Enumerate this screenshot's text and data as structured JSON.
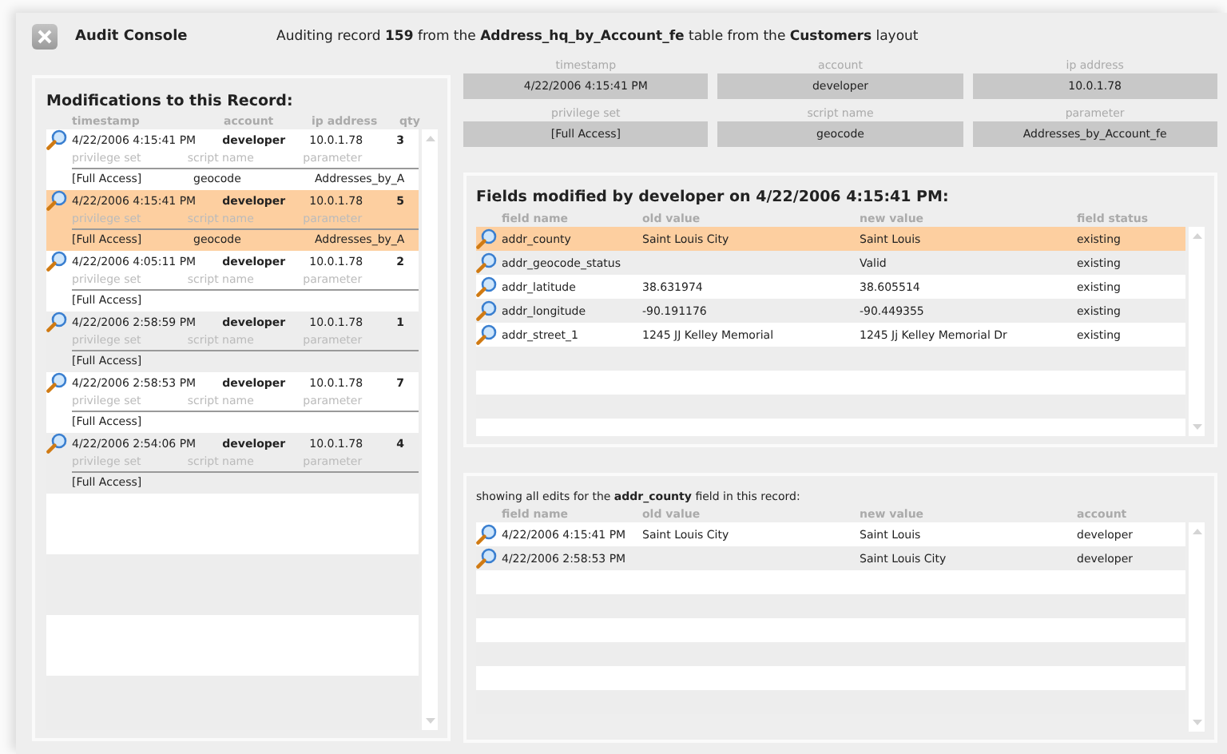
{
  "window": {
    "title": "Audit Console"
  },
  "header": {
    "text": "Auditing record **159** from the **Address_hq_by_Account_fe** table from the **Customers** layout"
  },
  "modifications": {
    "title": "Modifications to this Record:",
    "columns": [
      "timestamp",
      "account",
      "ip address",
      "qty"
    ],
    "rows": [
      {
        "timestamp": "4/22/2006 4:15:41 PM",
        "account": "developer",
        "ip_address": "10.0.1.78",
        "qty": "3",
        "labels": [
          "privilege set",
          "script name",
          "parameter"
        ],
        "privilege_set": "[Full Access]",
        "script_name": "geocode",
        "parameter": "Addresses_by_A",
        "selected": false
      },
      {
        "timestamp": "4/22/2006 4:15:41 PM",
        "account": "developer",
        "ip_address": "10.0.1.78",
        "qty": "5",
        "labels": [
          "privilege set",
          "script name",
          "parameter"
        ],
        "privilege_set": "[Full Access]",
        "script_name": "geocode",
        "parameter": "Addresses_by_A",
        "selected": true
      },
      {
        "timestamp": "4/22/2006 4:05:11 PM",
        "account": "developer",
        "ip_address": "10.0.1.78",
        "qty": "2",
        "labels": [
          "privilege set",
          "script name",
          "parameter"
        ],
        "privilege_set": "[Full Access]",
        "selected": false
      },
      {
        "timestamp": "4/22/2006 2:58:59 PM",
        "account": "developer",
        "ip_address": "10.0.1.78",
        "qty": "1",
        "labels": [
          "privilege set",
          "script name",
          "parameter"
        ],
        "privilege_set": "[Full Access]",
        "selected": false
      },
      {
        "timestamp": "4/22/2006 2:58:53 PM",
        "account": "developer",
        "ip_address": "10.0.1.78",
        "qty": "7",
        "labels": [
          "privilege set",
          "script name",
          "parameter"
        ],
        "privilege_set": "[Full Access]",
        "selected": false
      },
      {
        "timestamp": "4/22/2006 2:54:06 PM",
        "account": "developer",
        "ip_address": "10.0.1.78",
        "qty": "4",
        "labels": [
          "privilege set",
          "script name",
          "parameter"
        ],
        "privilege_set": "[Full Access]",
        "selected": false
      }
    ]
  },
  "details": [
    {
      "label": "timestamp",
      "value": "4/22/2006 4:15:41 PM"
    },
    {
      "label": "account",
      "value": "developer"
    },
    {
      "label": "ip address",
      "value": "10.0.1.78"
    },
    {
      "label": "privilege set",
      "value": "[Full Access]"
    },
    {
      "label": "script name",
      "value": "geocode"
    },
    {
      "label": "parameter",
      "value": "Addresses_by_Account_fe"
    }
  ],
  "fields_modified": {
    "title": "Fields modified by developer on 4/22/2006 4:15:41 PM:",
    "columns": [
      "field name",
      "old value",
      "new value",
      "field status"
    ],
    "rows": [
      {
        "field_name": "addr_county",
        "old_value": "Saint Louis City",
        "new_value": "Saint Louis",
        "field_status": "existing",
        "selected": true
      },
      {
        "field_name": "addr_geocode_status",
        "new_value": "Valid",
        "field_status": "existing",
        "selected": false
      },
      {
        "field_name": "addr_latitude",
        "old_value": "38.631974",
        "new_value": "38.605514",
        "field_status": "existing",
        "selected": false
      },
      {
        "field_name": "addr_longitude",
        "old_value": "-90.191176",
        "new_value": "-90.449355",
        "field_status": "existing",
        "selected": false
      },
      {
        "field_name": "addr_street_1",
        "old_value": "1245 JJ Kelley Memorial",
        "new_value": "1245 Jj Kelley Memorial Dr",
        "field_status": "existing",
        "selected": false
      }
    ]
  },
  "field_edits": {
    "caption": "showing all edits for the **addr_county** field in this record:",
    "columns": [
      "field name",
      "old value",
      "new value",
      "account"
    ],
    "rows": [
      {
        "timestamp": "4/22/2006 4:15:41 PM",
        "old_value": "Saint Louis City",
        "new_value": "Saint Louis",
        "account": "developer"
      },
      {
        "timestamp": "4/22/2006 2:58:53 PM",
        "new_value": "Saint Louis City",
        "account": "developer"
      }
    ]
  }
}
